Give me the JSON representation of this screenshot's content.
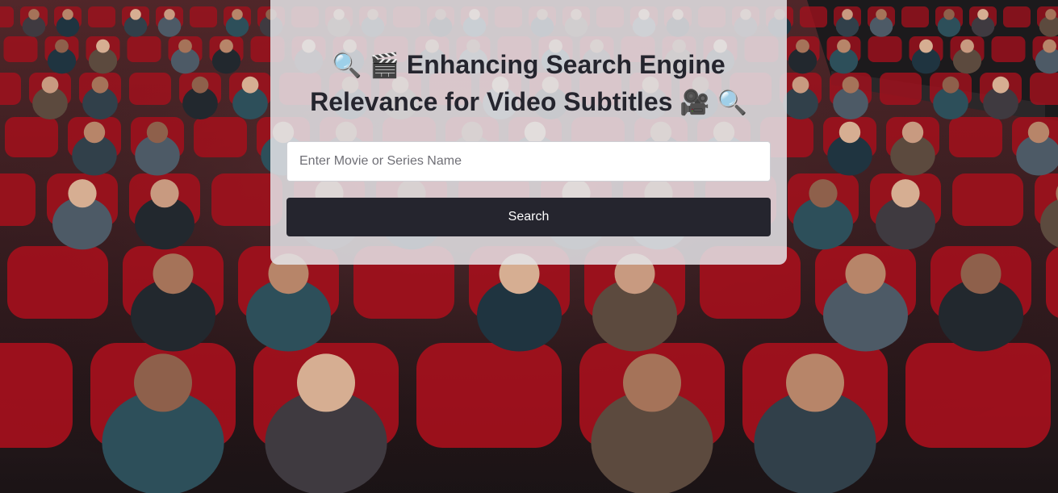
{
  "page": {
    "background_image": "cinema-audience-photo"
  },
  "search_card": {
    "title_icon_left_1": "🔍",
    "title_icon_left_2": "🎬",
    "title_line1": "Enhancing Search Engine",
    "title_line2": "Relevance for Video Subtitles",
    "title_icon_right_1": "🎥",
    "title_icon_right_2": "🔍",
    "input": {
      "value": "",
      "placeholder": "Enter Movie or Series Name"
    },
    "button_label": "Search"
  },
  "colors": {
    "title_text": "#25252e",
    "button_bg": "#25252e",
    "button_text": "#ffffff",
    "card_bg": "#e4e4e8",
    "seat_red": "#a5101c"
  }
}
